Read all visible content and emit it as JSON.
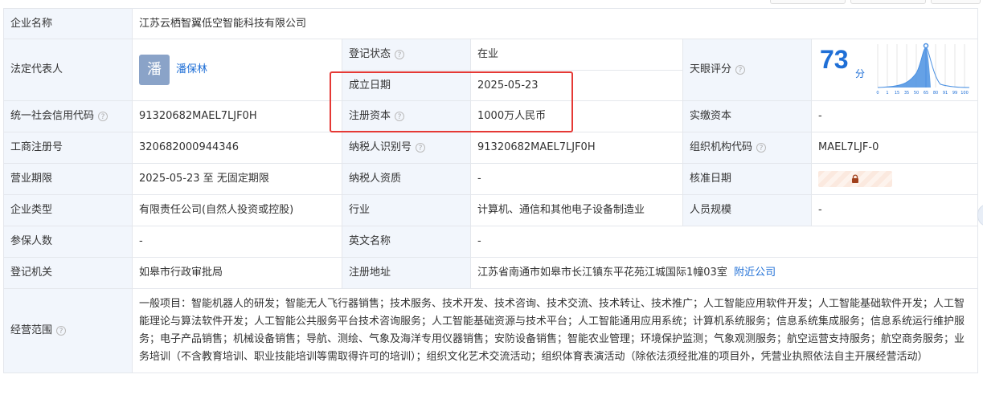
{
  "rows": {
    "company_name": {
      "label": "企业名称",
      "value": "江苏云栖智翼低空智能科技有限公司"
    },
    "legal_rep": {
      "label": "法定代表人",
      "avatar_char": "潘",
      "name": "潘保林"
    },
    "reg_status": {
      "label": "登记状态",
      "value": "在业"
    },
    "found_date": {
      "label": "成立日期",
      "value": "2025-05-23"
    },
    "reg_capital": {
      "label": "注册资本",
      "value": "1000万人民币"
    },
    "score": {
      "label": "天眼评分",
      "value": "73",
      "unit": "分",
      "axis_ticks": [
        "0",
        "1",
        "15",
        "35",
        "50",
        "65",
        "80",
        "91",
        "99",
        "100"
      ]
    },
    "credit_code": {
      "label": "统一社会信用代码",
      "value": "91320682MAEL7LJF0H"
    },
    "paid_capital": {
      "label": "实缴资本",
      "value": "-"
    },
    "biz_reg_no": {
      "label": "工商注册号",
      "value": "320682000944346"
    },
    "taxpayer_id": {
      "label": "纳税人识别号",
      "value": "91320682MAEL7LJF0H"
    },
    "org_code": {
      "label": "组织机构代码",
      "value": "MAEL7LJF-0"
    },
    "biz_term": {
      "label": "营业期限",
      "value": "2025-05-23 至 无固定期限"
    },
    "taxpayer_qual": {
      "label": "纳税人资质",
      "value": "-"
    },
    "approve_date": {
      "label": "核准日期"
    },
    "company_type": {
      "label": "企业类型",
      "value": "有限责任公司(自然人投资或控股)"
    },
    "industry": {
      "label": "行业",
      "value": "计算机、通信和其他电子设备制造业"
    },
    "staff_size": {
      "label": "人员规模",
      "value": "-"
    },
    "insured": {
      "label": "参保人数",
      "value": "-"
    },
    "english_name": {
      "label": "英文名称",
      "value": "-"
    },
    "reg_authority": {
      "label": "登记机关",
      "value": "如皋市行政审批局"
    },
    "reg_address": {
      "label": "注册地址",
      "value": "江苏省南通市如皋市长江镇东平花苑江城国际1幢03室",
      "link": "附近公司"
    },
    "biz_scope": {
      "label": "经营范围",
      "value": "一般项目：智能机器人的研发；智能无人飞行器销售；技术服务、技术开发、技术咨询、技术交流、技术转让、技术推广；人工智能应用软件开发；人工智能基础软件开发；人工智能理论与算法软件开发；人工智能公共服务平台技术咨询服务；人工智能基础资源与技术平台；人工智能通用应用系统；计算机系统服务；信息系统集成服务；信息系统运行维护服务；电子产品销售；机械设备销售；导航、测绘、气象及海洋专用仪器销售；安防设备销售；智能农业管理；环境保护监测；气象观测服务；航空运营支持服务；航空商务服务；业务培训（不含教育培训、职业技能培训等需取得许可的培训）；组织文化艺术交流活动；组织体育表演活动（除依法须经批准的项目外，凭营业执照依法自主开展经营活动）"
    }
  },
  "colors": {
    "label_bg": "#f2f6fc",
    "accent": "#1f6fd6",
    "status_green": "#08a36a",
    "highlight_red": "#e53935"
  }
}
